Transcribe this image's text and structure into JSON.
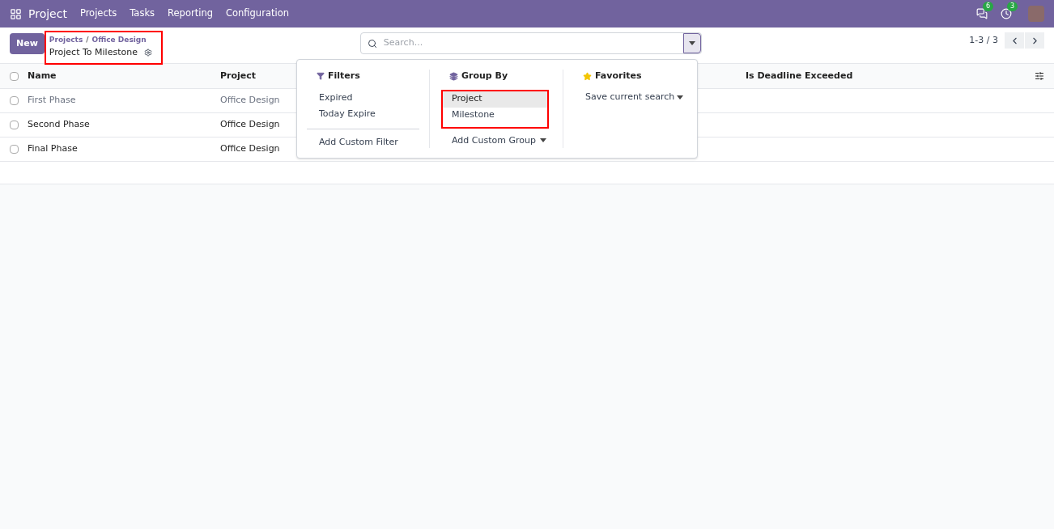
{
  "navbar": {
    "app_name": "Project",
    "menu": [
      "Projects",
      "Tasks",
      "Reporting",
      "Configuration"
    ],
    "messages_count": "6",
    "activities_count": "3"
  },
  "control_panel": {
    "new_button": "New",
    "breadcrumb": [
      "Projects",
      "Office Design"
    ],
    "breadcrumb_separator": "/",
    "title": "Project To Milestone",
    "search": {
      "placeholder": "Search..."
    },
    "pager": "1-3 / 3"
  },
  "table": {
    "all_checked": false,
    "columns": [
      "Name",
      "Project",
      "Is Deadline Exceeded"
    ],
    "rows": [
      {
        "name": "First Phase",
        "project": "Office Design",
        "muted": true,
        "checked": false
      },
      {
        "name": "Second Phase",
        "project": "Office Design",
        "muted": false,
        "checked": false
      },
      {
        "name": "Final Phase",
        "project": "Office Design",
        "muted": false,
        "checked": false
      }
    ]
  },
  "search_panel": {
    "filters": {
      "title": "Filters",
      "items": [
        "Expired",
        "Today Expire"
      ],
      "custom": "Add Custom Filter"
    },
    "group_by": {
      "title": "Group By",
      "items": [
        {
          "label": "Project",
          "selected": true
        },
        {
          "label": "Milestone",
          "selected": false
        }
      ],
      "custom": "Add Custom Group"
    },
    "favorites": {
      "title": "Favorites",
      "items": [
        "Save current search"
      ]
    }
  }
}
